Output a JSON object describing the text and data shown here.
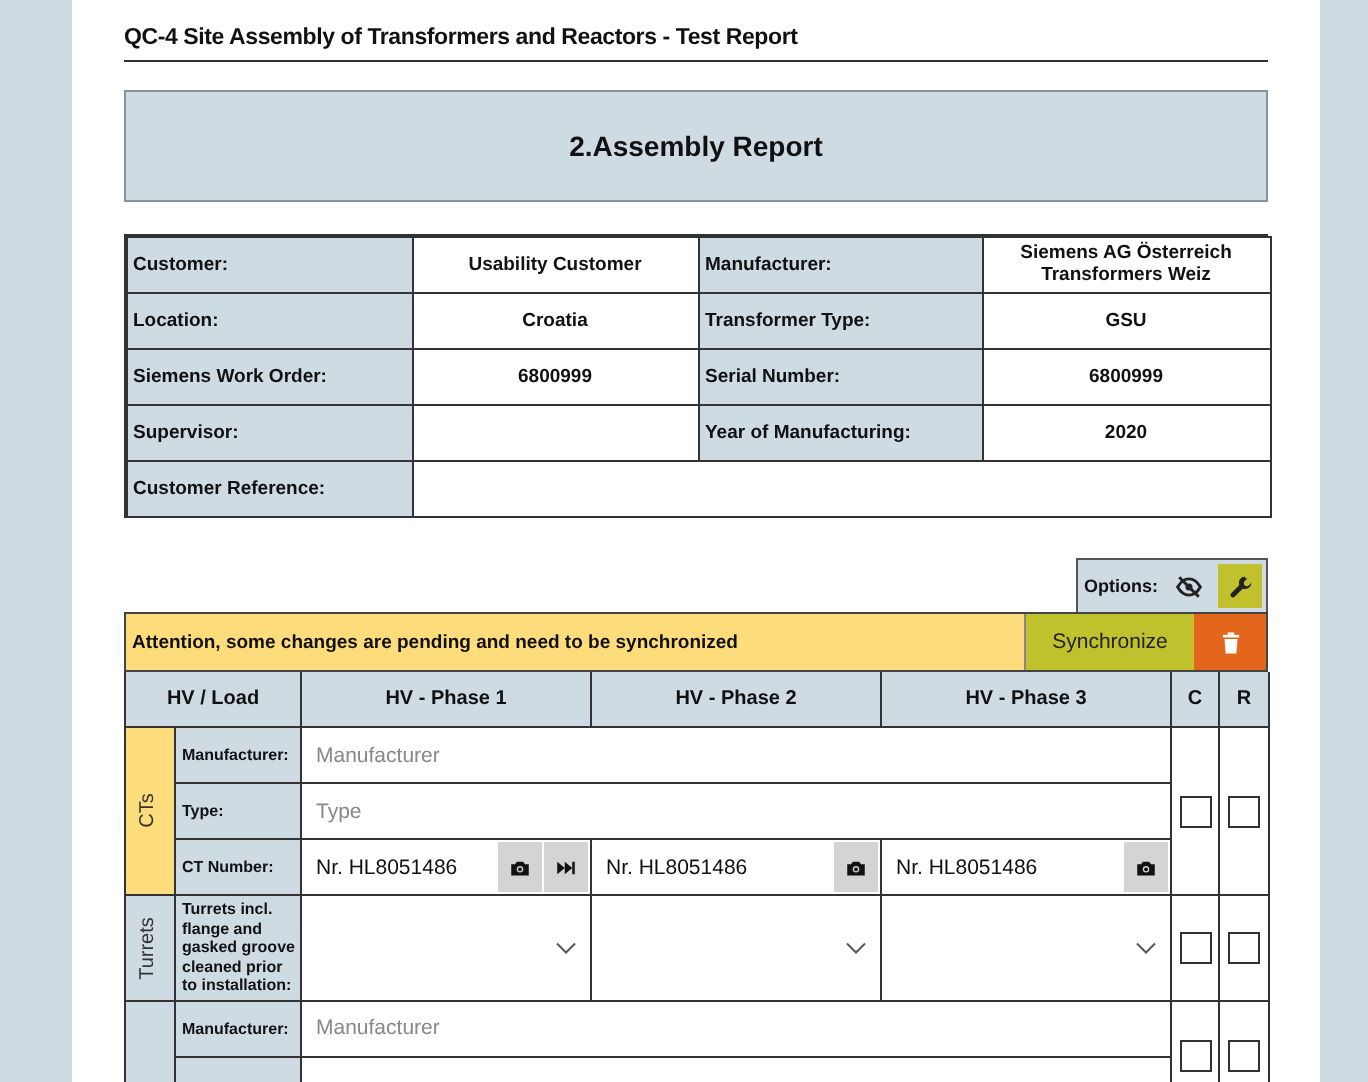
{
  "document_title": "QC-4 Site Assembly of Transformers and Reactors - Test Report",
  "section_title": "2.Assembly Report",
  "info_table": [
    [
      {
        "label": "Customer:",
        "value": "Usability Customer"
      },
      {
        "label": "Manufacturer:",
        "value": "Siemens AG Österreich Transformers Weiz"
      }
    ],
    [
      {
        "label": "Location:",
        "value": "Croatia"
      },
      {
        "label": "Transformer Type:",
        "value": "GSU"
      }
    ],
    [
      {
        "label": "Siemens Work Order:",
        "value": "6800999"
      },
      {
        "label": "Serial Number:",
        "value": "6800999"
      }
    ],
    [
      {
        "label": "Supervisor:"
      },
      {
        "label": "Year of Manufacturing:",
        "value": "2020"
      }
    ],
    [
      {
        "label": "Customer Reference:"
      }
    ]
  ],
  "options": {
    "label": "Options:"
  },
  "alert": {
    "message": "Attention, some changes are pending and need to be synchronized",
    "sync_button": "Synchronize"
  },
  "columns": [
    "HV / Load",
    "HV - Phase 1",
    "HV - Phase 2",
    "HV - Phase 3",
    "C",
    "R"
  ],
  "groups": [
    {
      "label": "CTs",
      "color": "#fddd7b",
      "c_checked": false,
      "r_checked": false,
      "rows": [
        {
          "kind": "text",
          "label": "Manufacturer:",
          "placeholder": "Manufacturer"
        },
        {
          "kind": "text",
          "label": "Type:",
          "placeholder": "Type"
        },
        {
          "kind": "phases",
          "label": "CT Number:",
          "values": [
            {
              "value": "Nr. HL8051486",
              "skip": true
            },
            {
              "value": "Nr. HL8051486",
              "skip": false
            },
            {
              "value": "Nr. HL8051486",
              "skip": false
            }
          ]
        }
      ]
    },
    {
      "label": "Turrets",
      "color": "#cfdbe3",
      "c_checked": false,
      "r_checked": false,
      "rows": [
        {
          "kind": "select",
          "label": "Turrets incl. flange and gasked groove cleaned prior to installation:"
        }
      ]
    },
    {
      "color": "#cfdbe3",
      "c_checked": false,
      "r_checked": false,
      "rows": [
        {
          "kind": "text",
          "label": "Manufacturer:",
          "placeholder": "Manufacturer"
        },
        {
          "kind": "text"
        }
      ]
    }
  ]
}
